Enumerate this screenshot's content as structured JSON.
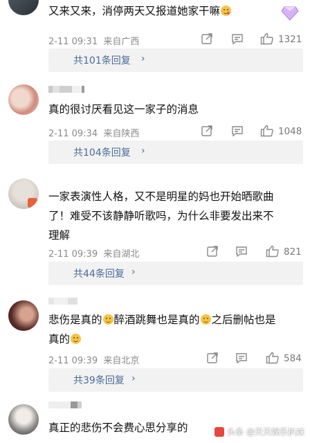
{
  "comments": [
    {
      "text_a": "又来又来，消停两天又报道她家干嘛",
      "time": "2-11 09:31",
      "location": "来自广西",
      "likes": "1321",
      "replies": "共101条回复",
      "chevron": "›"
    },
    {
      "text": "真的很讨厌看见这一家子的消息",
      "time": "2-11 09:34",
      "location": "来自陕西",
      "likes": "1048",
      "replies": "共104条回复",
      "chevron": "›"
    },
    {
      "line1": "一家表演性人格，又不是明星的妈也开始晒歌曲",
      "line2": "了！难受不该静静听歌吗，为什么非要发出来不",
      "line3": "理解",
      "time": "2-11 09:39",
      "location": "来自湖北",
      "likes": "821",
      "replies": "共44条回复",
      "chevron": "›"
    },
    {
      "seg1": "悲伤是真的",
      "seg2": "醉酒跳舞也是真的",
      "seg3": "之后删帖也是",
      "seg4": "真的",
      "time": "2-11 09:39",
      "location": "来自北京",
      "likes": "584",
      "replies": "共39条回复",
      "chevron": "›"
    },
    {
      "text": "真正的悲伤不会费心思分享的"
    }
  ],
  "watermark": "头条 @天天娱乐扒妹",
  "colors": {
    "reply_link": "#4a6a9a",
    "meta_gray": "#8a8a8a",
    "reply_bg": "#f2f2f2"
  }
}
